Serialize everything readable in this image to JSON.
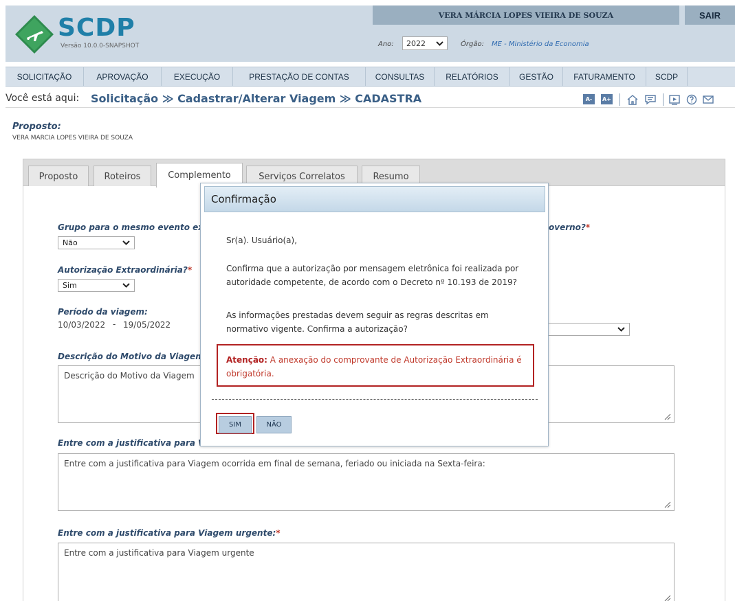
{
  "header": {
    "app_name": "SCDP",
    "version": "Versão 10.0.0-SNAPSHOT",
    "user_name": "VERA MÁRCIA LOPES VIEIRA DE SOUZA",
    "logout_label": "SAIR",
    "ano_label": "Ano:",
    "ano_value": "2022",
    "orgao_label": "Órgão:",
    "orgao_value": "ME - Ministério da Economia"
  },
  "nav": {
    "items": [
      "SOLICITAÇÃO",
      "APROVAÇÃO",
      "EXECUÇÃO",
      "PRESTAÇÃO DE CONTAS",
      "CONSULTAS",
      "RELATÓRIOS",
      "GESTÃO",
      "FATURAMENTO",
      "SCDP"
    ]
  },
  "breadcrumb": {
    "prefix": "Você está aqui:",
    "path": "Solicitação ≫ Cadastrar/Alterar Viagem ≫ CADASTRA"
  },
  "toolbar": {
    "font_decrease": "A-",
    "font_increase": "A+",
    "icons": [
      "home-icon",
      "chat-icon",
      "video-icon",
      "help-icon",
      "mail-icon"
    ]
  },
  "proposto": {
    "title": "Proposto:",
    "name": "VERA MARCIA LOPES VIEIRA DE SOUZA"
  },
  "tabs": [
    "Proposto",
    "Roteiros",
    "Complemento",
    "Serviços Correlatos",
    "Resumo"
  ],
  "active_tab": "Complemento",
  "form": {
    "grupo_label": "Grupo para o mesmo evento ex",
    "grupo_value": "Não",
    "governo_label_tail": "overno?",
    "autorizacao_label": "Autorização Extraordinária?",
    "autorizacao_value": "Sim",
    "periodo_label": "Período da viagem:",
    "periodo_start": "10/03/2022",
    "periodo_sep": "-",
    "periodo_end": "19/05/2022",
    "motivo_label": "Descrição do Motivo da Viagem",
    "motivo_placeholder": "Descrição do Motivo da Viagem",
    "fds_label": "Entre com a justificativa para V",
    "fds_placeholder": "Entre com a justificativa para Viagem ocorrida em final de semana, feriado ou iniciada na Sexta-feira:",
    "urgente_label": "Entre com a justificativa para Viagem urgente:",
    "urgente_placeholder": "Entre com a justificativa para Viagem urgente"
  },
  "modal": {
    "title": "Confirmação",
    "greeting": "Sr(a). Usuário(a),",
    "question_line1": "Confirma que a autorização por mensagem eletrônica foi realizada por",
    "question_line2": "autoridade competente, de acordo com o Decreto nº 10.193 de 2019?",
    "info_line1": "As informações prestadas devem seguir as regras descritas em",
    "info_line2": "normativo vigente. Confirma a autorização?",
    "warning_label": "Atenção:",
    "warning_text1": "A anexação do comprovante de Autorização Extraordinária é",
    "warning_text2": "obrigatória.",
    "yes_label": "SIM",
    "no_label": "NÃO"
  },
  "colors": {
    "brand": "#1f7fa8",
    "header_bg": "#cdd9e4",
    "label_blue": "#2e4a6b",
    "warning_red": "#b22222",
    "logo_green": "#2e8b4e"
  }
}
